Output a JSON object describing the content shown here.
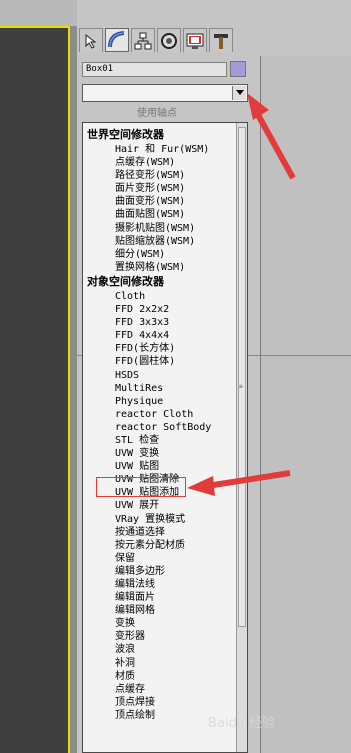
{
  "object_name": "Box01",
  "object_color": "#a49bd6",
  "modifier_list_value": "",
  "pivot_button_label": "使用轴点",
  "tabs": [
    "create-icon",
    "modify-icon",
    "hierarchy-icon",
    "motion-icon",
    "display-icon",
    "utilities-icon"
  ],
  "dropdown": {
    "world_header": "世界空间修改器",
    "world_items": [
      "Hair 和 Fur(WSM)",
      "点缓存(WSM)",
      "路径变形(WSM)",
      "面片变形(WSM)",
      "曲面变形(WSM)",
      "曲面贴图(WSM)",
      "摄影机贴图(WSM)",
      "贴图缩放器(WSM)",
      "细分(WSM)",
      "置换网格(WSM)"
    ],
    "object_header": "对象空间修改器",
    "object_items": [
      "Cloth",
      "FFD 2x2x2",
      "FFD 3x3x3",
      "FFD 4x4x4",
      "FFD(长方体)",
      "FFD(圆柱体)",
      "HSDS",
      "MultiRes",
      "Physique",
      "reactor Cloth",
      "reactor SoftBody",
      "STL 检查",
      "UVW 变换",
      "UVW 贴图",
      "UVW 贴图清除",
      "UVW 贴图添加",
      "UVW 展开",
      "VRay 置换模式",
      "按通道选择",
      "按元素分配材质",
      "保留",
      "编辑多边形",
      "编辑法线",
      "编辑面片",
      "编辑网格",
      "变换",
      "变形器",
      "波浪",
      "补洞",
      "材质",
      "点缓存",
      "顶点焊接",
      "顶点绘制"
    ]
  },
  "watermark": "Baidu 经验",
  "colors": {
    "highlight": "#e23b3b",
    "viewport_border": "#e3e000"
  }
}
